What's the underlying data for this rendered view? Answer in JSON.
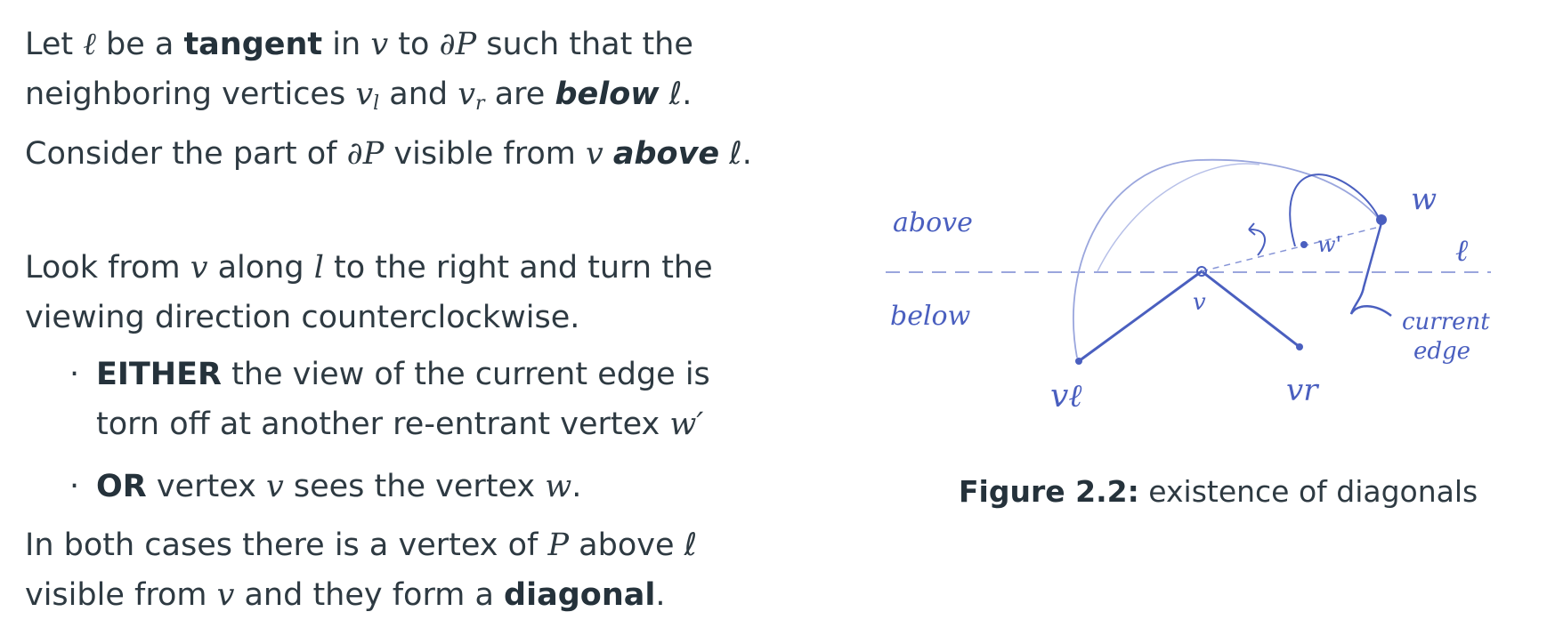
{
  "text": {
    "p1": {
      "l1_a": "Let ",
      "ell": "ℓ",
      "l1_b": " be a ",
      "tangent": "tangent",
      "l1_c": " in ",
      "v": "v",
      "l1_d": " to ",
      "dP": "∂P",
      "l1_e": " such that the",
      "l2_a": "neighboring vertices  ",
      "vl_base": "v",
      "vl_sub": "l",
      "l2_b": " and ",
      "vr_base": "v",
      "vr_sub": "r",
      "l2_c": " are ",
      "below": "below",
      "l2_d": " ℓ.",
      "l3_a": "Consider the part of ",
      "l3_b": " visible from ",
      "above": "above",
      "l3_c": " ℓ."
    },
    "p2": {
      "l1_a": "Look from ",
      "l1_b": " along ",
      "l": "l",
      "l1_c": " to the right and turn the",
      "l2": "viewing direction counterclockwise."
    },
    "bullets": {
      "dot": "·",
      "b1_bold": "EITHER",
      "b1_a": " the view of the current edge is",
      "b1_b": "torn off at another re-entrant vertex ",
      "w_prime": "w′",
      "b2_bold": "OR",
      "b2_a": " vertex ",
      "b2_b": " sees the vertex ",
      "w": "w",
      "b2_c": "."
    },
    "p3": {
      "l1_a": "In both cases there is a vertex of ",
      "P": "P",
      "l1_b": " above ℓ",
      "l2_a": "visible from ",
      "l2_b": " and they form a ",
      "diagonal": "diagonal",
      "l2_c": "."
    }
  },
  "figure": {
    "labels": {
      "above": "above",
      "below": "below",
      "v": "v",
      "vl": "vℓ",
      "vr": "vr",
      "w": "w",
      "w_prime": "w'",
      "ell": "ℓ",
      "current": "current",
      "edge": "edge"
    },
    "caption_prefix": "Figure 2.2:",
    "caption_text": " existence of diagonals",
    "colors": {
      "ink": "#4a5fbf",
      "ink_light": "#9aa6dd",
      "text": "#2e3a42"
    }
  }
}
